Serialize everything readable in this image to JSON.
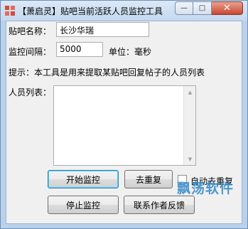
{
  "window": {
    "title": "【萧启灵】贴吧当前活跃人员监控工具",
    "controls": {
      "minimize": "—",
      "maximize": "□",
      "close": "✕"
    }
  },
  "form": {
    "tieba_name_label": "贴吧名称：",
    "tieba_name_value": "长沙华瑞",
    "interval_label": "监控间隔：",
    "interval_value": "5000",
    "unit_label": "单位：毫秒",
    "hint": "提示：本工具是用来提取某贴吧回复帖子的人员列表",
    "member_list_label": "人员列表："
  },
  "buttons": {
    "start": "开始监控",
    "dedupe": "去重复",
    "auto_dedupe": "自动去重复",
    "stop": "停止监控",
    "contact": "联系作者反馈"
  },
  "watermark": "飘荡软件"
}
